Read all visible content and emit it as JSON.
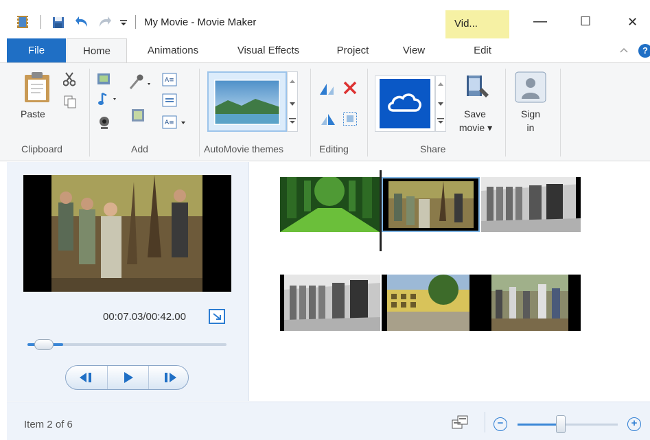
{
  "window": {
    "title": "My Movie - Movie Maker",
    "contextual_tab": "Vid...",
    "minimize": "—",
    "maximize": "☐",
    "close": "✕"
  },
  "tabs": [
    "File",
    "Home",
    "Animations",
    "Visual Effects",
    "Project",
    "View",
    "Edit"
  ],
  "ribbon": {
    "paste_label": "Paste",
    "groups": {
      "clipboard": "Clipboard",
      "add": "Add",
      "automovie": "AutoMovie themes",
      "editing": "Editing",
      "share": "Share"
    },
    "save_movie_line1": "Save",
    "save_movie_line2": "movie ▾",
    "sign_in_line1": "Sign",
    "sign_in_line2": "in"
  },
  "preview": {
    "timecode": "00:07.03/00:42.00",
    "seek_fraction": 0.18
  },
  "status": {
    "item_text": "Item 2 of 6",
    "zoom_fraction": 0.45
  },
  "icons": {
    "app": "film-icon",
    "save": "save-icon",
    "undo": "undo-icon",
    "redo": "redo-icon",
    "qat": "qat-dropdown-icon",
    "help": "help-icon"
  }
}
